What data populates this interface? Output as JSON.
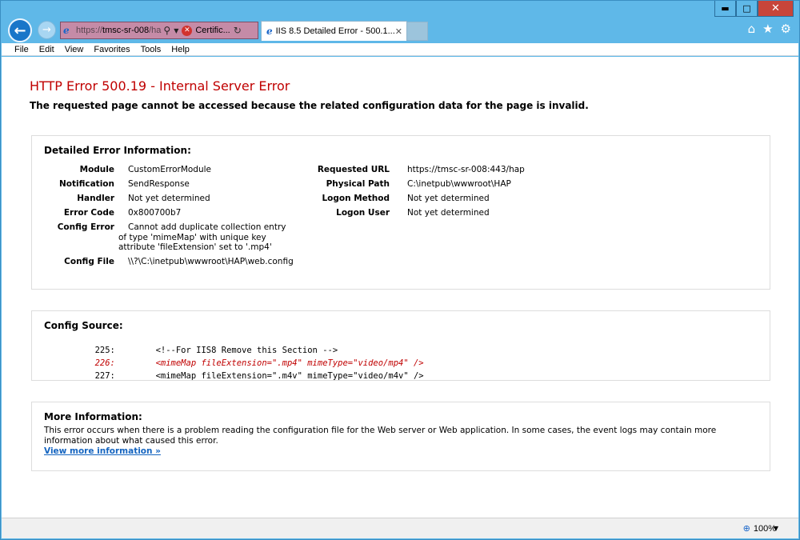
{
  "window": {
    "caption_buttons": {
      "minimize": "▬",
      "maximize": "□",
      "close": "✕"
    }
  },
  "nav": {
    "address_scheme": "https://",
    "address_host": "tmsc-sr-008",
    "address_path": "/ha",
    "cert_label": "Certific...",
    "tab_title": "IIS 8.5 Detailed Error - 500.1...",
    "tab_close": "✕"
  },
  "menu": [
    "File",
    "Edit",
    "View",
    "Favorites",
    "Tools",
    "Help"
  ],
  "page": {
    "title": "HTTP Error 500.19 - Internal Server Error",
    "subtitle": "The requested page cannot be accessed because the related configuration data for the page is invalid.",
    "details_heading": "Detailed Error Information:",
    "details_left": [
      {
        "key": "Module",
        "value": "CustomErrorModule"
      },
      {
        "key": "Notification",
        "value": "SendResponse"
      },
      {
        "key": "Handler",
        "value": "Not yet determined"
      },
      {
        "key": "Error Code",
        "value": "0x800700b7"
      },
      {
        "key": "Config Error",
        "value": "Cannot add duplicate collection entry of type 'mimeMap' with unique key attribute 'fileExtension' set to '.mp4'"
      },
      {
        "key": "Config File",
        "value": "\\\\?\\C:\\inetpub\\wwwroot\\HAP\\web.config"
      }
    ],
    "details_right": [
      {
        "key": "Requested URL",
        "value": "https://tmsc-sr-008:443/hap"
      },
      {
        "key": "Physical Path",
        "value": "C:\\inetpub\\wwwroot\\HAP"
      },
      {
        "key": "Logon Method",
        "value": "Not yet determined"
      },
      {
        "key": "Logon User",
        "value": "Not yet determined"
      }
    ],
    "config_heading": "Config Source:",
    "config_lines": [
      {
        "num": "225:",
        "code": "<!--For IIS8 Remove this Section -->",
        "highlight": false
      },
      {
        "num": "226:",
        "code": "<mimeMap fileExtension=\".mp4\" mimeType=\"video/mp4\" />",
        "highlight": true
      },
      {
        "num": "227:",
        "code": "<mimeMap fileExtension=\".m4v\" mimeType=\"video/m4v\" />",
        "highlight": false
      }
    ],
    "more_heading": "More Information:",
    "more_text": "This error occurs when there is a problem reading the configuration file for the Web server or Web application. In some cases, the event logs may contain more information about what caused this error.",
    "more_link": "View more information »"
  },
  "status": {
    "zoom": "100%"
  },
  "colors": {
    "error_red": "#c00000",
    "link_blue": "#1565c0",
    "frame_blue": "#5fb8e8"
  }
}
